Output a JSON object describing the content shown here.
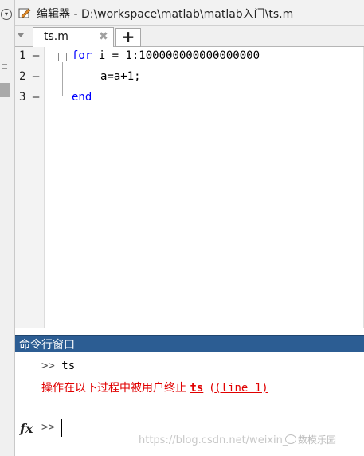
{
  "editor": {
    "title": "编辑器 - D:\\workspace\\matlab\\matlab入门\\ts.m",
    "tabs": [
      {
        "label": "ts.m",
        "close": "✖"
      }
    ],
    "add_tab": "+",
    "lines": [
      {
        "number": "1",
        "marker": "—",
        "keyword": "for",
        "rest": " i = 1:100000000000000000"
      },
      {
        "number": "2",
        "marker": "—",
        "text": "a=a+1;"
      },
      {
        "number": "3",
        "marker": "—",
        "keyword": "end"
      }
    ]
  },
  "command_window": {
    "title": "命令行窗口",
    "history_prompt": ">> ",
    "history_cmd": "ts",
    "error_prefix": "操作在以下过程中被用户终止 ",
    "error_func": "ts",
    "error_loc": "(line 1)",
    "fx": "fx",
    "prompt": ">>"
  },
  "watermark": {
    "url": "https://blog.csdn.net/weixin_",
    "brand": "数模乐园"
  },
  "colors": {
    "keyword": "#0000ff",
    "error": "#e00000",
    "cmd_title_bg": "#2c5d93"
  }
}
